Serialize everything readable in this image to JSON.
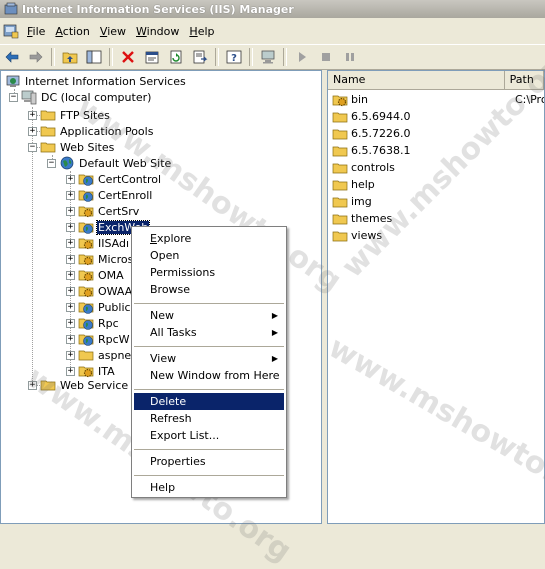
{
  "window": {
    "title": "Internet Information Services (IIS) Manager"
  },
  "menu": [
    {
      "label": "File",
      "hot": "F",
      "rest": "ile"
    },
    {
      "label": "Action",
      "hot": "A",
      "rest": "ction"
    },
    {
      "label": "View",
      "hot": "V",
      "rest": "iew"
    },
    {
      "label": "Window",
      "hot": "W",
      "rest": "indow"
    },
    {
      "label": "Help",
      "hot": "H",
      "rest": "elp"
    }
  ],
  "toolbar": [
    "back-icon",
    "forward-icon",
    "up-folder-icon",
    "show-tree-icon",
    "delete-icon",
    "properties-icon",
    "refresh-icon",
    "export-icon",
    "help-icon",
    "computer-icon",
    "start-icon",
    "stop-icon",
    "pause-icon"
  ],
  "tree": {
    "root": "Internet Information Services",
    "computer": "DC (local computer)",
    "ftp": "FTP Sites",
    "apppools": "Application Pools",
    "websites": "Web Sites",
    "defaultsite": "Default Web Site",
    "children": [
      "CertControl",
      "CertEnroll",
      "CertSrv",
      "ExchWeb",
      "IISAdmin",
      "Microsoft-Server-ActiveSync",
      "OMA",
      "OWA",
      "Public",
      "Rpc",
      "RpcWithCert",
      "aspnet_client",
      "ITA"
    ],
    "children_visible": [
      "CertControl",
      "CertEnroll",
      "CertSrv",
      "ExchWeb",
      "IISAdı",
      "Micros",
      "OMA",
      "OWAA",
      "Public",
      "Rpc",
      "RpcW",
      "aspne",
      "ITA"
    ],
    "webservice": "Web Service E"
  },
  "list": {
    "columns": [
      "Name",
      "Path"
    ],
    "items": [
      {
        "name": "bin",
        "path": "C:\\Pro"
      },
      {
        "name": "6.5.6944.0",
        "path": ""
      },
      {
        "name": "6.5.7226.0",
        "path": ""
      },
      {
        "name": "6.5.7638.1",
        "path": ""
      },
      {
        "name": "controls",
        "path": ""
      },
      {
        "name": "help",
        "path": ""
      },
      {
        "name": "img",
        "path": ""
      },
      {
        "name": "themes",
        "path": ""
      },
      {
        "name": "views",
        "path": ""
      }
    ]
  },
  "context_menu": {
    "explore": "Explore",
    "open": "Open",
    "permissions": "Permissions",
    "browse": "Browse",
    "new": "New",
    "all_tasks": "All Tasks",
    "view": "View",
    "new_window": "New Window from Here",
    "delete": "Delete",
    "refresh": "Refresh",
    "export_list": "Export List...",
    "properties": "Properties",
    "help": "Help"
  },
  "watermark": "www.mshowto.org",
  "colors": {
    "selection": "#0a246a",
    "folder": "#f0c850",
    "globe": "#2a8a4a"
  }
}
